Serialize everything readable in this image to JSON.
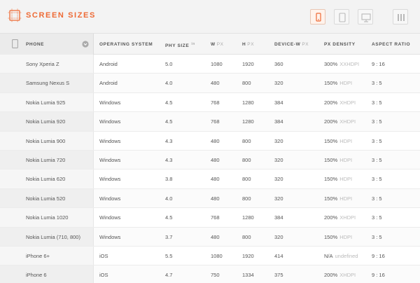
{
  "header": {
    "title": "SCREEN SIZES",
    "accent_color": "#ee6a35",
    "device_buttons": [
      {
        "icon": "phone-icon",
        "active": true
      },
      {
        "icon": "tablet-icon",
        "active": false
      },
      {
        "icon": "desktop-icon",
        "active": false
      },
      {
        "icon": "columns-icon",
        "active": false
      }
    ]
  },
  "table": {
    "columns": {
      "phone": "PHONE",
      "os": "OPERATING SYSTEM",
      "phy_size": "PHY SIZE",
      "phy_size_unit": "in",
      "w": "W",
      "w_unit": "PX",
      "h": "H",
      "h_unit": "PX",
      "device_w": "DEVICE-W",
      "device_w_unit": "PX",
      "px_density": "PX DENSITY",
      "aspect": "ASPECT RATIO"
    },
    "rows": [
      {
        "phone": "Sony Xperia Z",
        "os": "Android",
        "size": "5.0",
        "w": "1080",
        "h": "1920",
        "dw": "360",
        "density": "300%",
        "dpi": "XXHDPI",
        "aspect": "9 : 16"
      },
      {
        "phone": "Samsung Nexus S",
        "os": "Android",
        "size": "4.0",
        "w": "480",
        "h": "800",
        "dw": "320",
        "density": "150%",
        "dpi": "HDPI",
        "aspect": "3 : 5"
      },
      {
        "phone": "Nokia Lumia 925",
        "os": "Windows",
        "size": "4.5",
        "w": "768",
        "h": "1280",
        "dw": "384",
        "density": "200%",
        "dpi": "XHDPI",
        "aspect": "3 : 5"
      },
      {
        "phone": "Nokia Lumia 920",
        "os": "Windows",
        "size": "4.5",
        "w": "768",
        "h": "1280",
        "dw": "384",
        "density": "200%",
        "dpi": "XHDPI",
        "aspect": "3 : 5"
      },
      {
        "phone": "Nokia Lumia 900",
        "os": "Windows",
        "size": "4.3",
        "w": "480",
        "h": "800",
        "dw": "320",
        "density": "150%",
        "dpi": "HDPI",
        "aspect": "3 : 5"
      },
      {
        "phone": "Nokia Lumia 720",
        "os": "Windows",
        "size": "4.3",
        "w": "480",
        "h": "800",
        "dw": "320",
        "density": "150%",
        "dpi": "HDPI",
        "aspect": "3 : 5"
      },
      {
        "phone": "Nokia Lumia 620",
        "os": "Windows",
        "size": "3.8",
        "w": "480",
        "h": "800",
        "dw": "320",
        "density": "150%",
        "dpi": "HDPI",
        "aspect": "3 : 5"
      },
      {
        "phone": "Nokia Lumia 520",
        "os": "Windows",
        "size": "4.0",
        "w": "480",
        "h": "800",
        "dw": "320",
        "density": "150%",
        "dpi": "HDPI",
        "aspect": "3 : 5"
      },
      {
        "phone": "Nokia Lumia 1020",
        "os": "Windows",
        "size": "4.5",
        "w": "768",
        "h": "1280",
        "dw": "384",
        "density": "200%",
        "dpi": "XHDPI",
        "aspect": "3 : 5"
      },
      {
        "phone": "Nokia Lumia (710, 800)",
        "os": "Windows",
        "size": "3.7",
        "w": "480",
        "h": "800",
        "dw": "320",
        "density": "150%",
        "dpi": "HDPI",
        "aspect": "3 : 5"
      },
      {
        "phone": "iPhone 6+",
        "os": "iOS",
        "size": "5.5",
        "w": "1080",
        "h": "1920",
        "dw": "414",
        "density": "N/A",
        "dpi": "undefined",
        "aspect": "9 : 16"
      },
      {
        "phone": "iPhone 6",
        "os": "iOS",
        "size": "4.7",
        "w": "750",
        "h": "1334",
        "dw": "375",
        "density": "200%",
        "dpi": "XHDPI",
        "aspect": "9 : 16"
      }
    ]
  }
}
